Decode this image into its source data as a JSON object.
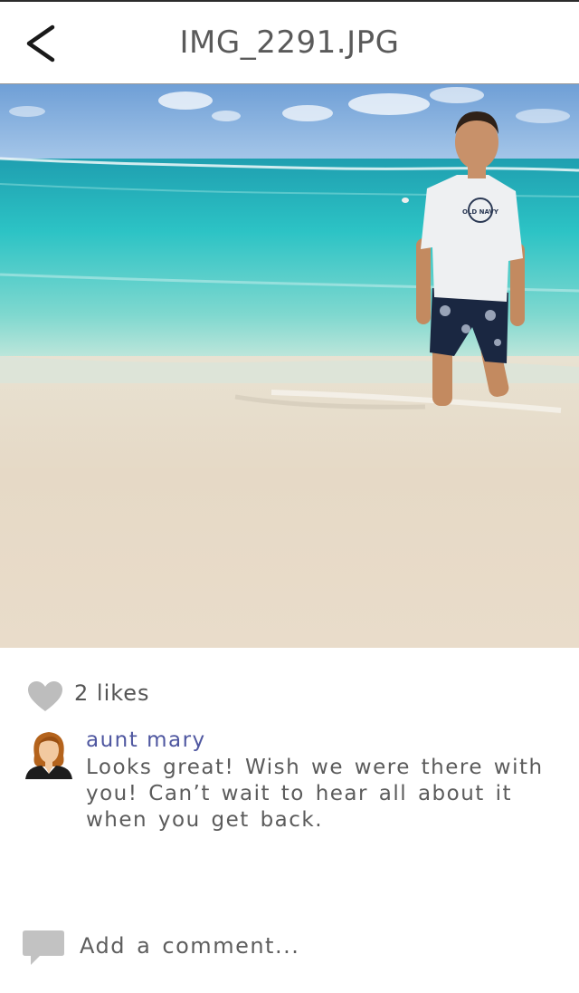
{
  "header": {
    "title": "IMG_2291.JPG",
    "back_icon": "chevron-left-icon"
  },
  "photo": {
    "shirt_logo_text": "OLD NAVY"
  },
  "likes": {
    "icon": "heart-icon",
    "text": "2 likes"
  },
  "comments": [
    {
      "author": "aunt mary",
      "avatar_icon": "woman-avatar-icon",
      "text": "Looks great! Wish we were there with you! Can’t wait to hear all about it when you get back."
    }
  ],
  "add_comment": {
    "icon": "speech-bubble-icon",
    "placeholder": "Add a comment..."
  },
  "colors": {
    "author": "#4f57a0",
    "text": "#5b5b5b",
    "icon_gray": "#bdbdbd"
  }
}
